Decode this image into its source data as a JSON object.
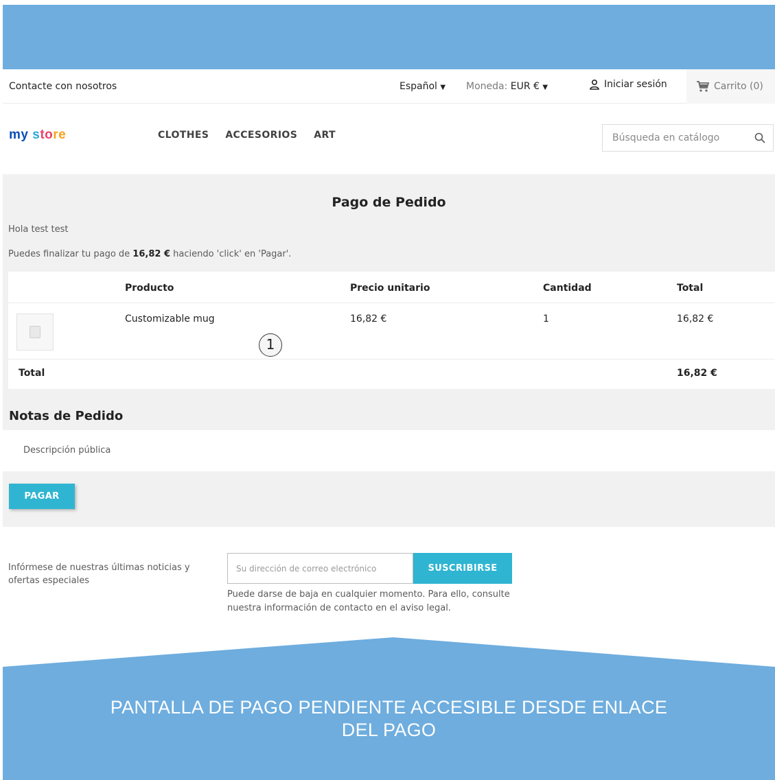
{
  "header": {
    "contact": "Contacte con nosotros",
    "language": "Español",
    "currency_label": "Moneda:",
    "currency_value": "EUR €",
    "login": "Iniciar sesión",
    "cart": "Carrito (0)"
  },
  "logo": {
    "part1": "my",
    "part2": " s",
    "part3": "to",
    "part4": "re"
  },
  "menu": {
    "items": [
      "CLOTHES",
      "ACCESORIOS",
      "ART"
    ]
  },
  "search": {
    "placeholder": "Búsqueda en catálogo"
  },
  "order": {
    "title": "Pago de Pedido",
    "greeting": "Hola test test",
    "message_prefix": "Puedes finalizar tu pago de ",
    "message_amount": "16,82 €",
    "message_suffix": " haciendo 'click' en 'Pagar'.",
    "columns": {
      "product": "Producto",
      "unit_price": "Precio unitario",
      "quantity": "Cantidad",
      "total": "Total"
    },
    "row": {
      "product": "Customizable mug",
      "unit_price": "16,82 €",
      "quantity": "1",
      "total": "16,82 €"
    },
    "total_label": "Total",
    "total_value": "16,82 €",
    "marker": "1"
  },
  "notes": {
    "heading": "Notas de Pedido",
    "text": "Descripción pública"
  },
  "pay_button": "PAGAR",
  "newsletter": {
    "text": "Infórmese de nuestras últimas noticias y ofertas especiales",
    "placeholder": "Su dirección de correo electrónico",
    "button": "SUSCRIBIRSE",
    "note": "Puede darse de baja en cualquier momento. Para ello, consulte nuestra información de contacto en el aviso legal."
  },
  "banner": {
    "line1": "PANTALLA DE PAGO PENDIENTE ACCESIBLE DESDE ENLACE",
    "line2": "DEL PAGO"
  },
  "colors": {
    "accent": "#2fb5d2",
    "banner": "#6eadde",
    "content_bg": "#f1f1f1"
  }
}
